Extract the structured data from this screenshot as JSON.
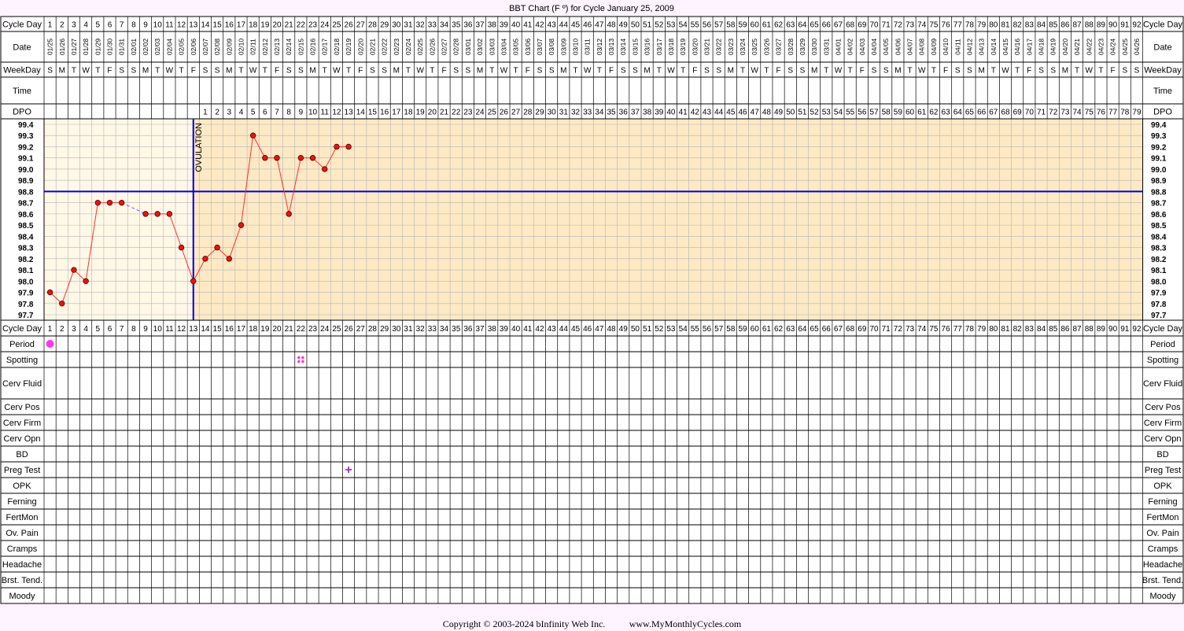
{
  "header": {
    "title": "BBT Chart (F º) for Cycle January 25, 2009"
  },
  "labels": {
    "cycle_day": "Cycle Day",
    "date": "Date",
    "weekday": "WeekDay",
    "time": "Time",
    "dpo": "DPO",
    "ovulation": "OVULATION",
    "rows": [
      "Period",
      "Spotting",
      "Cerv Fluid",
      "Cerv Pos",
      "Cerv Firm",
      "Cerv Opn",
      "BD",
      "Preg Test",
      "OPK",
      "Ferning",
      "FertMon",
      "Ov. Pain",
      "Cramps",
      "Headache",
      "Brst. Tend.",
      "Moody"
    ]
  },
  "footer": {
    "copyright": "Copyright © 2003-2024 bInfinity Web Inc.",
    "site": "www.MyMonthlyCycles.com"
  },
  "colors": {
    "preovulation_bg": "#fff8e7",
    "postovulation_bg": "#fde9c4",
    "grid": "#b5b5b5",
    "temp_line": "#ff3030",
    "point_fill": "#ee1111",
    "coverline": "#0000dd",
    "period_marker": "#ff33ff",
    "spotting_marker": "#ff33cc",
    "preg_test_marker": "#9933cc"
  },
  "chart_data": {
    "type": "line",
    "title": "BBT Chart (F º) for Cycle January 25, 2009",
    "xlabel": "Cycle Day",
    "ylabel": "",
    "days": 92,
    "dates": [
      "01/25",
      "01/26",
      "01/27",
      "01/28",
      "01/29",
      "01/30",
      "01/31",
      "02/01",
      "02/02",
      "02/03",
      "02/04",
      "02/05",
      "02/06",
      "02/07",
      "02/08",
      "02/09",
      "02/10",
      "02/11",
      "02/12",
      "02/13",
      "02/14",
      "02/15",
      "02/16",
      "02/17",
      "02/18",
      "02/19",
      "02/20",
      "02/21",
      "02/22",
      "02/23",
      "02/24",
      "02/25",
      "02/26",
      "02/27",
      "02/28",
      "03/01",
      "03/02",
      "03/03",
      "03/04",
      "03/05",
      "03/06",
      "03/07",
      "03/08",
      "03/09",
      "03/10",
      "03/11",
      "03/12",
      "03/13",
      "03/14",
      "03/15",
      "03/16",
      "03/17",
      "03/18",
      "03/19",
      "03/20",
      "03/21",
      "03/22",
      "03/23",
      "03/24",
      "03/25",
      "03/26",
      "03/27",
      "03/28",
      "03/29",
      "03/30",
      "03/31",
      "04/01",
      "04/02",
      "04/03",
      "04/04",
      "04/05",
      "04/06",
      "04/07",
      "04/08",
      "04/09",
      "04/10",
      "04/11",
      "04/12",
      "04/13",
      "04/14",
      "04/15",
      "04/16",
      "04/17",
      "04/18",
      "04/19",
      "04/20",
      "04/21",
      "04/22",
      "04/23",
      "04/24",
      "04/25",
      "04/26"
    ],
    "weekdays": [
      "S",
      "M",
      "T",
      "W",
      "T",
      "F",
      "S"
    ],
    "y_ticks": [
      "99.4",
      "99.3",
      "99.2",
      "99.1",
      "99.0",
      "98.9",
      "98.8",
      "98.7",
      "98.6",
      "98.5",
      "98.4",
      "98.3",
      "98.2",
      "98.1",
      "98.0",
      "97.9",
      "97.8",
      "97.7"
    ],
    "ylim": [
      97.7,
      99.4
    ],
    "temperatures": [
      {
        "day": 1,
        "temp": 97.9
      },
      {
        "day": 2,
        "temp": 97.8
      },
      {
        "day": 3,
        "temp": 98.1
      },
      {
        "day": 4,
        "temp": 98.0
      },
      {
        "day": 5,
        "temp": 98.7
      },
      {
        "day": 6,
        "temp": 98.7
      },
      {
        "day": 7,
        "temp": 98.7
      },
      {
        "day": 9,
        "temp": 98.6
      },
      {
        "day": 10,
        "temp": 98.6
      },
      {
        "day": 11,
        "temp": 98.6
      },
      {
        "day": 12,
        "temp": 98.3
      },
      {
        "day": 13,
        "temp": 98.0
      },
      {
        "day": 14,
        "temp": 98.2
      },
      {
        "day": 15,
        "temp": 98.3
      },
      {
        "day": 16,
        "temp": 98.2
      },
      {
        "day": 17,
        "temp": 98.5
      },
      {
        "day": 18,
        "temp": 99.3
      },
      {
        "day": 19,
        "temp": 99.1
      },
      {
        "day": 20,
        "temp": 99.1
      },
      {
        "day": 21,
        "temp": 98.6
      },
      {
        "day": 22,
        "temp": 99.1
      },
      {
        "day": 23,
        "temp": 99.1
      },
      {
        "day": 24,
        "temp": 99.0
      },
      {
        "day": 25,
        "temp": 99.2
      },
      {
        "day": 26,
        "temp": 99.2
      }
    ],
    "ovulation_day": 13,
    "coverline": 98.8,
    "dpo_count": 79,
    "period_days": [
      1
    ],
    "spotting_days": [
      22
    ],
    "preg_test_positive_days": [
      26
    ],
    "grid": true
  }
}
